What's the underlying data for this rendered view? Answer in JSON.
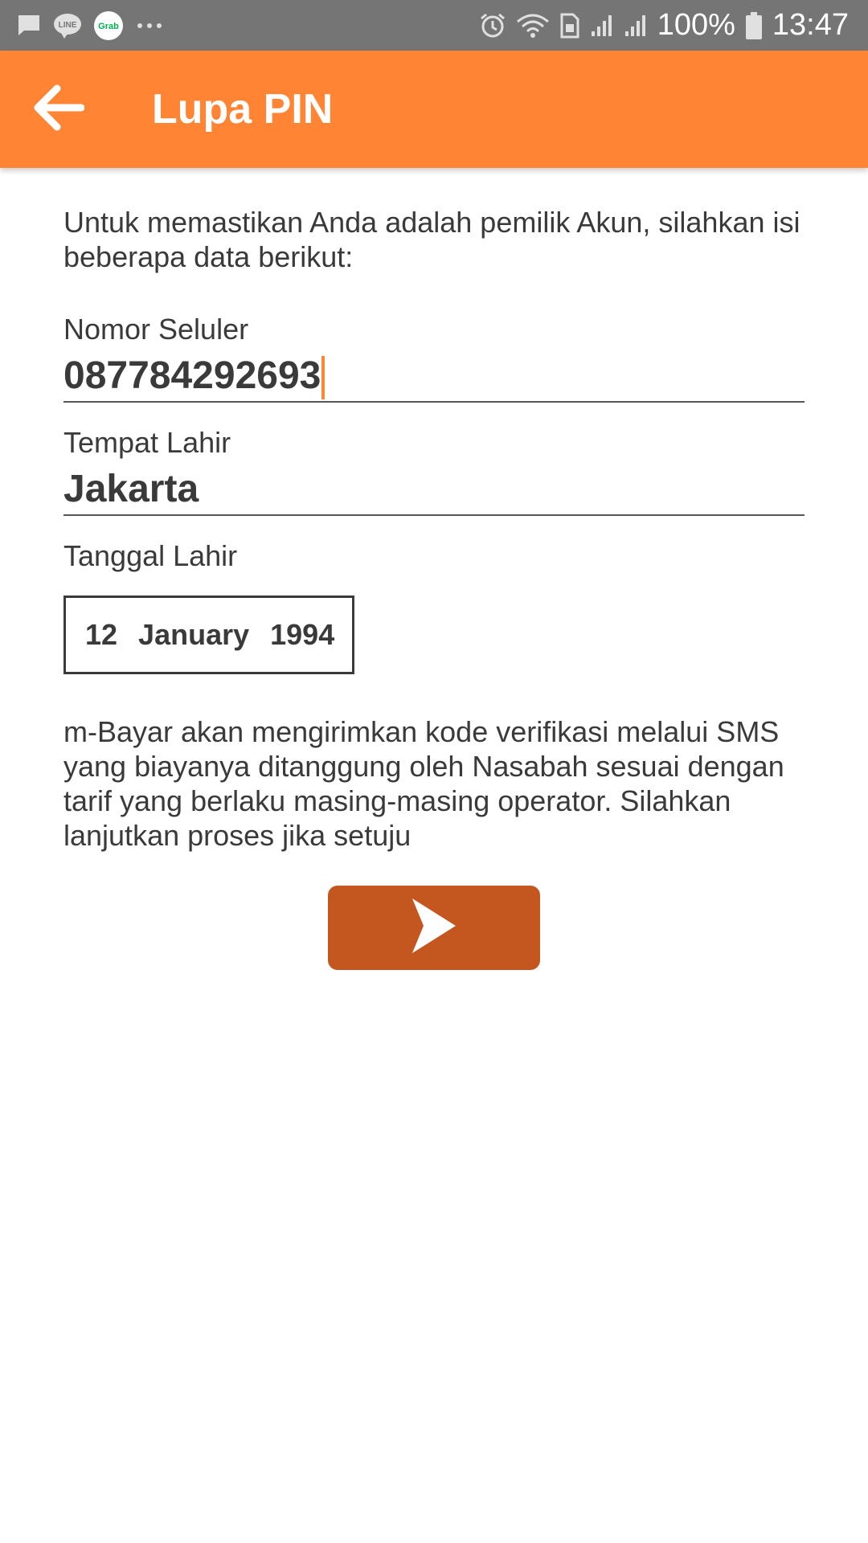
{
  "status_bar": {
    "left_icons": [
      "message-icon",
      "line-app-icon",
      "grab-app-icon",
      "more-notifications-icon"
    ],
    "grab_label": "Grab",
    "line_label": "LINE",
    "right_icons": [
      "alarm-icon",
      "wifi-icon",
      "sim-icon",
      "signal-icon",
      "signal-icon",
      "battery-icon"
    ],
    "battery": "100%",
    "time": "13:47"
  },
  "app_bar": {
    "title": "Lupa PIN",
    "background": "#ff8434"
  },
  "form": {
    "intro": "Untuk memastikan Anda adalah pemilik Akun, silahkan isi beberapa data berikut:",
    "phone": {
      "label": "Nomor Seluler",
      "value": "087784292693"
    },
    "birth_place": {
      "label": "Tempat Lahir",
      "value": "Jakarta"
    },
    "birth_date": {
      "label": "Tanggal Lahir",
      "day": "12",
      "month": "January",
      "year": "1994"
    },
    "disclaimer": "m-Bayar akan mengirimkan kode verifikasi melalui SMS yang biayanya ditanggung oleh Nasabah sesuai dengan tarif yang berlaku masing-masing operator. Silahkan lanjutkan proses jika setuju",
    "next_button": {
      "icon": "chevron-right-icon",
      "color": "#c4561f"
    }
  }
}
